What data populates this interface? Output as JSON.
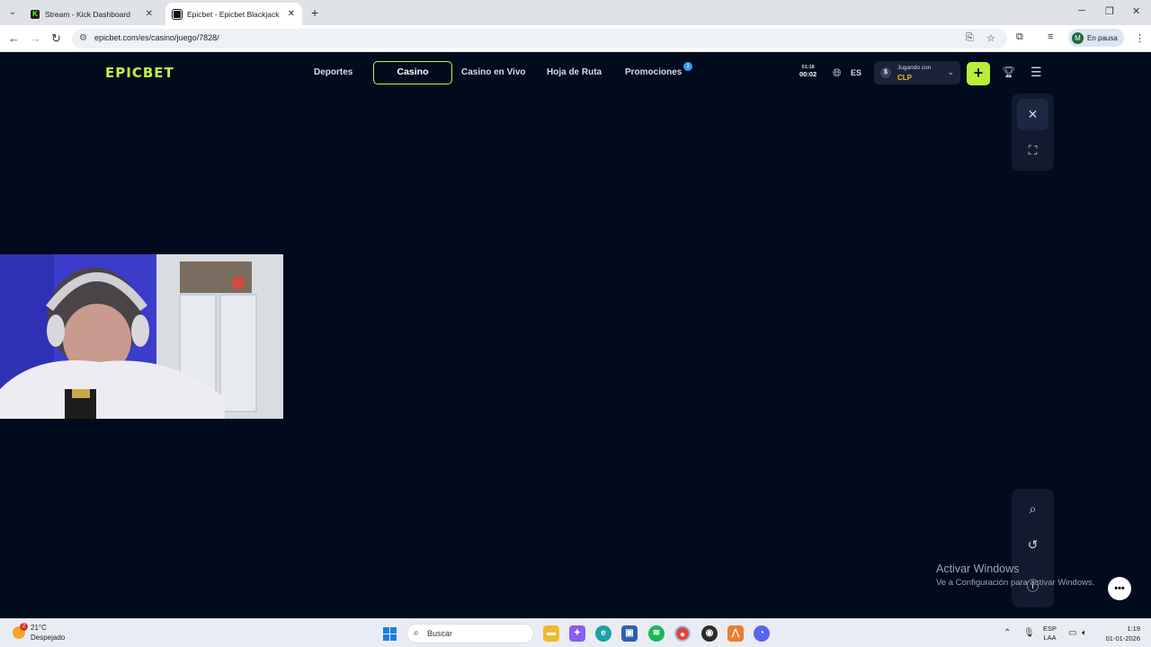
{
  "browser": {
    "tabs": [
      {
        "title": "Stream - Kick Dashboard",
        "active": false
      },
      {
        "title": "Epicbet - Epicbet Blackjack",
        "active": true
      }
    ],
    "url": "epicbet.com/es/casino/juego/7828/",
    "profile_status": "En pausa",
    "profile_initial": "M"
  },
  "site": {
    "logo": "EPICBET",
    "nav": {
      "deportes": "Deportes",
      "casino": "Casino",
      "casino_vivo": "Casino en Vivo",
      "hoja_ruta": "Hoja de Ruta",
      "promociones": "Promociones",
      "promo_badge": "1"
    },
    "timer": {
      "clock": "01:18",
      "elapsed": "00:02"
    },
    "language": "ES",
    "wallet": {
      "label": "Jugando con",
      "currency": "CLP",
      "symbol": "$"
    },
    "deposit_symbol": "+"
  },
  "windows_activation": {
    "title": "Activar Windows",
    "subtitle": "Ve a Configuración para activar Windows."
  },
  "taskbar": {
    "weather_temp": "21°C",
    "weather_desc": "Despejado",
    "weather_badge": "2",
    "search_placeholder": "Buscar",
    "lang_top": "ESP",
    "lang_bottom": "LAA",
    "time": "1:19",
    "date": "01-01-2026"
  },
  "colors": {
    "background": "#020b1e",
    "accent": "#c2f542",
    "wallet_currency": "#f2b51c"
  }
}
